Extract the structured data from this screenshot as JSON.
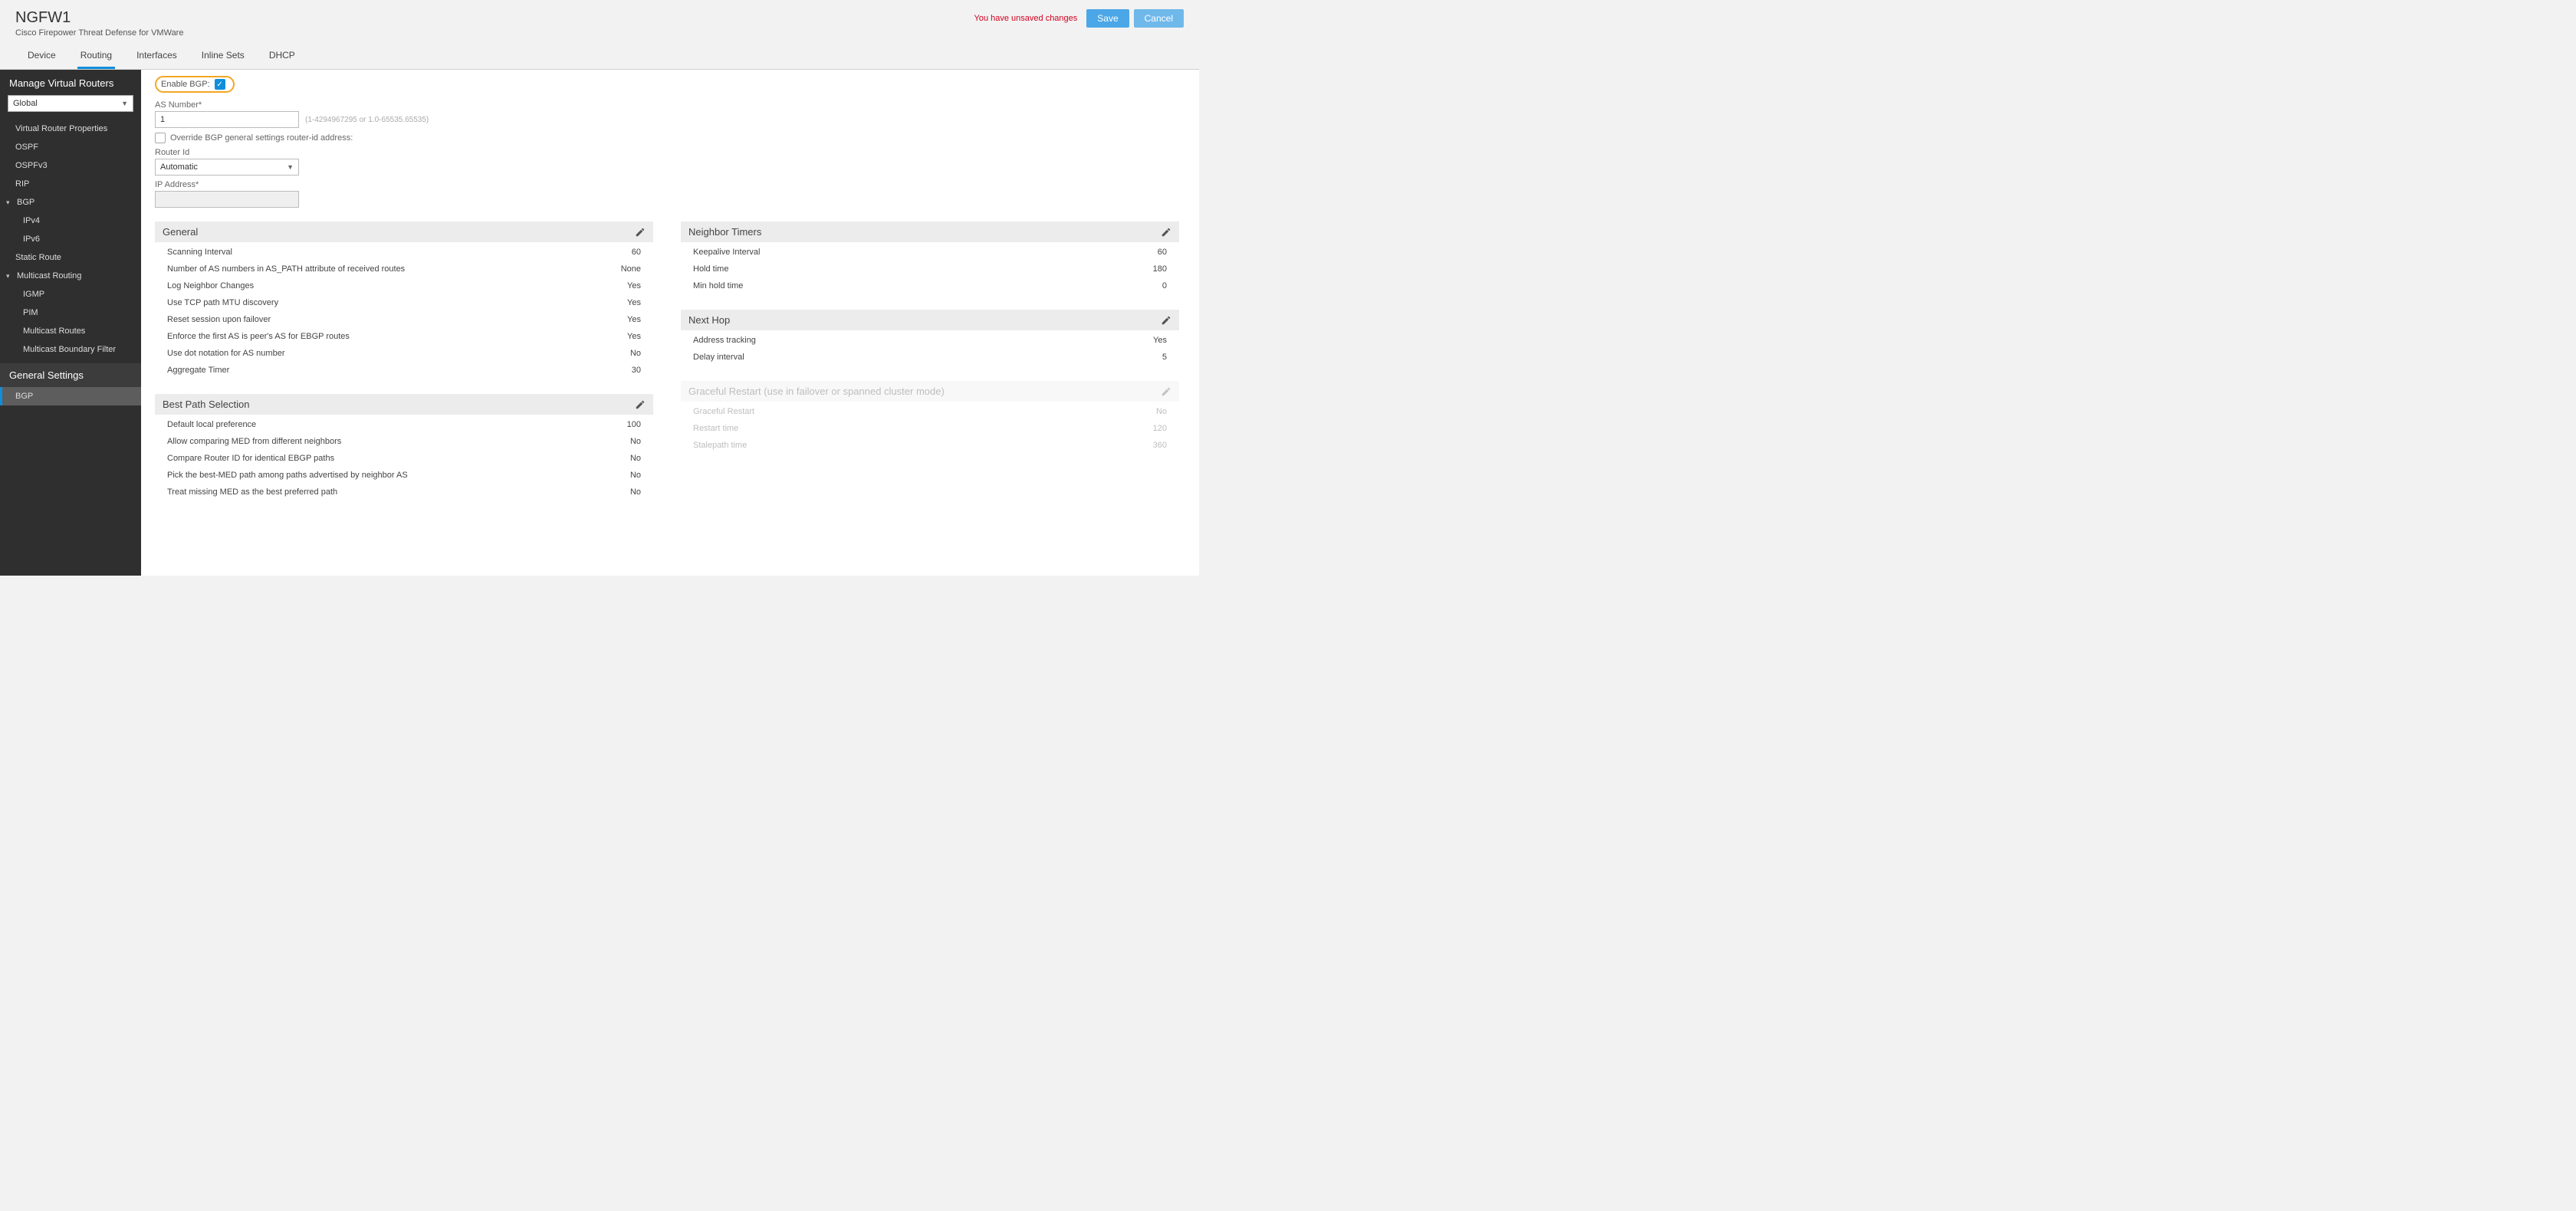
{
  "header": {
    "device_name": "NGFW1",
    "subtitle": "Cisco Firepower Threat Defense for VMWare",
    "unsaved_text": "You have unsaved changes",
    "save_label": "Save",
    "cancel_label": "Cancel"
  },
  "tabs": [
    "Device",
    "Routing",
    "Interfaces",
    "Inline Sets",
    "DHCP"
  ],
  "active_tab": "Routing",
  "sidebar": {
    "title": "Manage Virtual Routers",
    "router_selected": "Global",
    "items": [
      {
        "label": "Virtual Router Properties",
        "level": 0
      },
      {
        "label": "OSPF",
        "level": 0
      },
      {
        "label": "OSPFv3",
        "level": 0
      },
      {
        "label": "RIP",
        "level": 0
      },
      {
        "label": "BGP",
        "level": 0,
        "expandable": true
      },
      {
        "label": "IPv4",
        "level": 1
      },
      {
        "label": "IPv6",
        "level": 1
      },
      {
        "label": "Static Route",
        "level": 0
      },
      {
        "label": "Multicast Routing",
        "level": 0,
        "expandable": true
      },
      {
        "label": "IGMP",
        "level": 1
      },
      {
        "label": "PIM",
        "level": 1
      },
      {
        "label": "Multicast Routes",
        "level": 1
      },
      {
        "label": "Multicast Boundary Filter",
        "level": 1
      }
    ],
    "general_settings_label": "General Settings",
    "general_items": [
      {
        "label": "BGP",
        "active": true
      }
    ]
  },
  "bgp_form": {
    "enable_label": "Enable BGP:",
    "enable_checked": true,
    "as_number_label": "AS Number*",
    "as_number_value": "1",
    "as_number_hint": "(1-4294967295 or 1.0-65535.65535)",
    "override_label": "Override BGP general settings router-id address:",
    "override_checked": false,
    "router_id_label": "Router Id",
    "router_id_value": "Automatic",
    "ip_address_label": "IP Address*",
    "ip_address_value": ""
  },
  "panels": {
    "general": {
      "title": "General",
      "rows": [
        {
          "k": "Scanning Interval",
          "v": "60"
        },
        {
          "k": "Number of AS numbers in AS_PATH attribute of received routes",
          "v": "None"
        },
        {
          "k": "Log Neighbor Changes",
          "v": "Yes"
        },
        {
          "k": "Use TCP path MTU discovery",
          "v": "Yes"
        },
        {
          "k": "Reset session upon failover",
          "v": "Yes"
        },
        {
          "k": "Enforce the first AS is peer's AS for EBGP routes",
          "v": "Yes"
        },
        {
          "k": "Use dot notation for AS number",
          "v": "No"
        },
        {
          "k": "Aggregate Timer",
          "v": "30"
        }
      ]
    },
    "best_path": {
      "title": "Best Path Selection",
      "rows": [
        {
          "k": "Default local preference",
          "v": "100"
        },
        {
          "k": "Allow comparing MED from different neighbors",
          "v": "No"
        },
        {
          "k": "Compare Router ID for identical EBGP paths",
          "v": "No"
        },
        {
          "k": "Pick the best-MED path among paths advertised by neighbor AS",
          "v": "No"
        },
        {
          "k": "Treat missing MED as the best preferred path",
          "v": "No"
        }
      ]
    },
    "neighbor_timers": {
      "title": "Neighbor Timers",
      "rows": [
        {
          "k": "Keepalive Interval",
          "v": "60"
        },
        {
          "k": "Hold time",
          "v": "180"
        },
        {
          "k": "Min hold time",
          "v": "0"
        }
      ]
    },
    "next_hop": {
      "title": "Next Hop",
      "rows": [
        {
          "k": "Address tracking",
          "v": "Yes"
        },
        {
          "k": "Delay interval",
          "v": "5"
        }
      ]
    },
    "graceful_restart": {
      "title": "Graceful Restart (use in failover or spanned cluster mode)",
      "rows": [
        {
          "k": "Graceful Restart",
          "v": "No"
        },
        {
          "k": "Restart time",
          "v": "120"
        },
        {
          "k": "Stalepath time",
          "v": "360"
        }
      ]
    }
  }
}
